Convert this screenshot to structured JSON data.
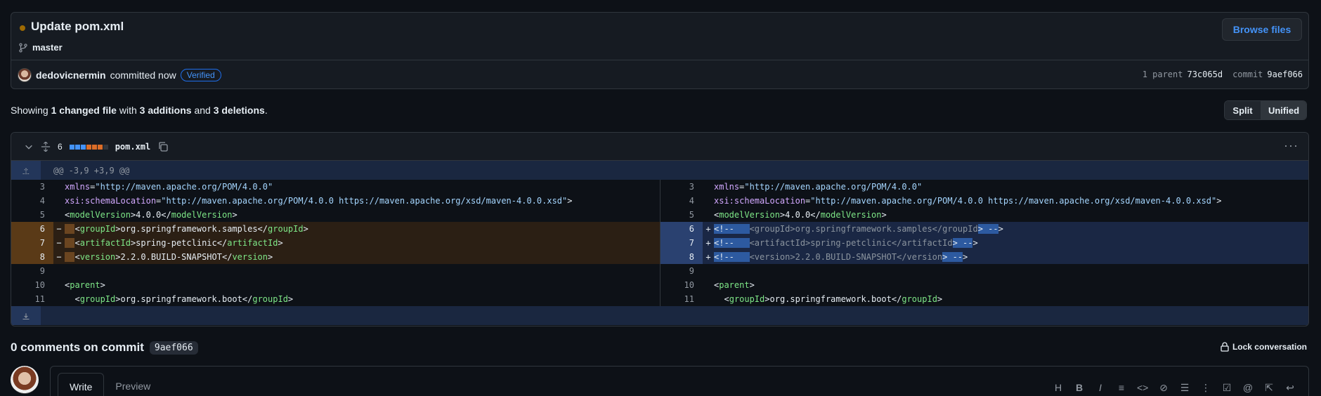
{
  "commit": {
    "title": "Update pom.xml",
    "branch": "master",
    "browse_label": "Browse files",
    "author": "dedovicnermin",
    "committed_text": "committed now",
    "verified": "Verified",
    "parent_label": "1 parent",
    "parent_sha": "73c065d",
    "commit_label": "commit",
    "commit_sha": "9aef066"
  },
  "summary": {
    "prefix": "Showing",
    "files": "1 changed file",
    "with": "with",
    "additions": "3 additions",
    "and": "and",
    "deletions": "3 deletions",
    "suffix": "."
  },
  "view_toggle": {
    "split": "Split",
    "unified": "Unified"
  },
  "file": {
    "changes": "6",
    "name": "pom.xml",
    "hunk": "@@ -3,9 +3,9 @@",
    "diffstat_colors": [
      "#4493f8",
      "#4493f8",
      "#4493f8",
      "#db6d28",
      "#db6d28",
      "#db6d28",
      "#30363d"
    ]
  },
  "left_lines": [
    {
      "n": "3",
      "mk": "",
      "html": "<span class='attr'>xmlns</span>=<span class='str'>\"http://maven.apache.org/POM/4.0.0\"</span>",
      "type": "ctx"
    },
    {
      "n": "4",
      "mk": "",
      "html": "<span class='attr'>xsi:schemaLocation</span>=<span class='str'>\"http://maven.apache.org/POM/4.0.0 https://maven.apache.org/xsd/maven-4.0.0.xsd\"</span>&gt;",
      "type": "ctx"
    },
    {
      "n": "5",
      "mk": "",
      "html": "&lt;<span class='tag'>modelVersion</span>&gt;4.0.0&lt;/<span class='tag'>modelVersion</span>&gt;",
      "type": "ctx"
    },
    {
      "n": "6",
      "mk": "−",
      "html": "<span class='hl-del'>  </span>&lt;<span class='tag'>groupId</span>&gt;org.springframework.samples&lt;/<span class='tag'>groupId</span>&gt;",
      "type": "del"
    },
    {
      "n": "7",
      "mk": "−",
      "html": "<span class='hl-del'>  </span>&lt;<span class='tag'>artifactId</span>&gt;spring-petclinic&lt;/<span class='tag'>artifactId</span>&gt;",
      "type": "del"
    },
    {
      "n": "8",
      "mk": "−",
      "html": "<span class='hl-del'>  </span>&lt;<span class='tag'>version</span>&gt;2.2.0.BUILD-SNAPSHOT&lt;/<span class='tag'>version</span>&gt;",
      "type": "del"
    },
    {
      "n": "9",
      "mk": "",
      "html": "",
      "type": "ctx"
    },
    {
      "n": "10",
      "mk": "",
      "html": "&lt;<span class='tag'>parent</span>&gt;",
      "type": "ctx"
    },
    {
      "n": "11",
      "mk": "",
      "html": "  &lt;<span class='tag'>groupId</span>&gt;org.springframework.boot&lt;/<span class='tag'>groupId</span>&gt;",
      "type": "ctx"
    }
  ],
  "right_lines": [
    {
      "n": "3",
      "mk": "",
      "html": "<span class='attr'>xmlns</span>=<span class='str'>\"http://maven.apache.org/POM/4.0.0\"</span>",
      "type": "ctx"
    },
    {
      "n": "4",
      "mk": "",
      "html": "<span class='attr'>xsi:schemaLocation</span>=<span class='str'>\"http://maven.apache.org/POM/4.0.0 https://maven.apache.org/xsd/maven-4.0.0.xsd\"</span>&gt;",
      "type": "ctx"
    },
    {
      "n": "5",
      "mk": "",
      "html": "&lt;<span class='tag'>modelVersion</span>&gt;4.0.0&lt;/<span class='tag'>modelVersion</span>&gt;",
      "type": "ctx"
    },
    {
      "n": "6",
      "mk": "+",
      "html": "<span class='hl-add'>&lt;!--   </span><span class='cm'>&lt;groupId&gt;org.springframework.samples&lt;/groupId</span><span class='hl-add'>&gt; --</span>&gt;",
      "type": "add"
    },
    {
      "n": "7",
      "mk": "+",
      "html": "<span class='hl-add'>&lt;!--   </span><span class='cm'>&lt;artifactId&gt;spring-petclinic&lt;/artifactId</span><span class='hl-add'>&gt; --</span>&gt;",
      "type": "add"
    },
    {
      "n": "8",
      "mk": "+",
      "html": "<span class='hl-add'>&lt;!--   </span><span class='cm'>&lt;version&gt;2.2.0.BUILD-SNAPSHOT&lt;/version</span><span class='hl-add'>&gt; --</span>&gt;",
      "type": "add"
    },
    {
      "n": "9",
      "mk": "",
      "html": "",
      "type": "ctx"
    },
    {
      "n": "10",
      "mk": "",
      "html": "&lt;<span class='tag'>parent</span>&gt;",
      "type": "ctx"
    },
    {
      "n": "11",
      "mk": "",
      "html": "  &lt;<span class='tag'>groupId</span>&gt;org.springframework.boot&lt;/<span class='tag'>groupId</span>&gt;",
      "type": "ctx"
    }
  ],
  "comments": {
    "title": "0 comments on commit",
    "sha": "9aef066",
    "lock_label": "Lock conversation",
    "tab_write": "Write",
    "tab_preview": "Preview",
    "toolbar_icons": [
      "heading-icon",
      "bold-icon",
      "italic-icon",
      "quote-icon",
      "code-icon",
      "link-icon",
      "unordered-list-icon",
      "ordered-list-icon",
      "task-list-icon",
      "mention-icon",
      "reference-icon",
      "reply-icon"
    ]
  }
}
